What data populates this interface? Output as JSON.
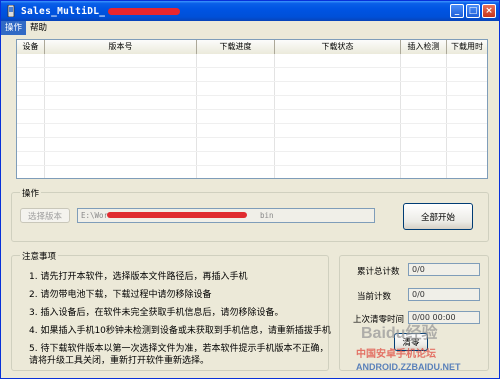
{
  "window": {
    "title": "Sales_MultiDL_",
    "minimize": "_",
    "maximize": "□",
    "close": "×"
  },
  "menu": [
    {
      "label": "操作"
    },
    {
      "label": "帮助"
    }
  ],
  "table": {
    "columns": [
      "设备",
      "版本号",
      "下载进度",
      "下载状态",
      "插入检测",
      "下载用时"
    ]
  },
  "operation": {
    "group_label": "操作",
    "select_version_button": "选择版本",
    "path_prefix": "E:\\Wor",
    "path_suffix": "bin",
    "start_all_button": "全部开始"
  },
  "notes": {
    "group_label": "注意事项",
    "items": [
      "1.  请先打开本软件，选择版本文件路径后，再插入手机",
      "2.  请勿带电池下载，下载过程中请勿移除设备",
      "3.  插入设备后，在软件未完全获取手机信息后，请勿移除设备。",
      "4.  如果插入手机10秒钟未检测到设备或未获取到手机信息，请重新插拔手机",
      "5.  待下载软件版本以第一次选择文件为准，若本软件提示手机版本不正确，",
      "     请将升级工具关闭，重新打开软件重新选择。"
    ]
  },
  "stats": {
    "total_label": "累计总计数",
    "total_value": "0/0",
    "current_label": "当前计数",
    "current_value": "0/0",
    "last_reset_label": "上次清零时间",
    "last_reset_value": "0/00 00:00",
    "reset_button": "清零"
  },
  "watermarks": {
    "baidu": "Baidu经验",
    "forum": "中国安卓手机论坛",
    "site": "ANDROID.ZZBAIDU.NET"
  }
}
